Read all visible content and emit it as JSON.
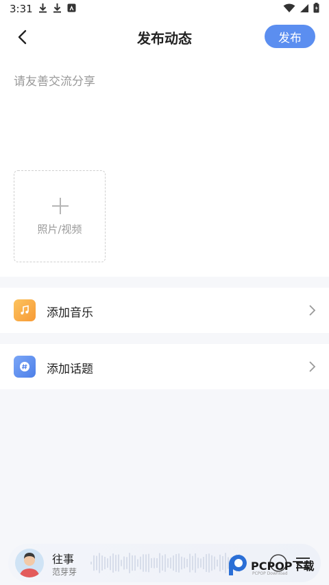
{
  "status_bar": {
    "time": "3:31"
  },
  "header": {
    "title": "发布动态",
    "publish_label": "发布"
  },
  "editor": {
    "placeholder": "请友善交流分享"
  },
  "media": {
    "label": "照片/视频"
  },
  "options": [
    {
      "label": "添加音乐",
      "icon": "music-note-icon",
      "color": "#f7a23a"
    },
    {
      "label": "添加话题",
      "icon": "hashtag-icon",
      "color": "#5b8ef0"
    }
  ],
  "player": {
    "title": "往事",
    "artist": "范芽芽"
  },
  "watermark": {
    "text": "PCPOP下载",
    "sub": "PCPOP Download"
  },
  "colors": {
    "accent": "#5b8ef0",
    "music": "#f7a23a",
    "background": "#f6f7fa"
  }
}
